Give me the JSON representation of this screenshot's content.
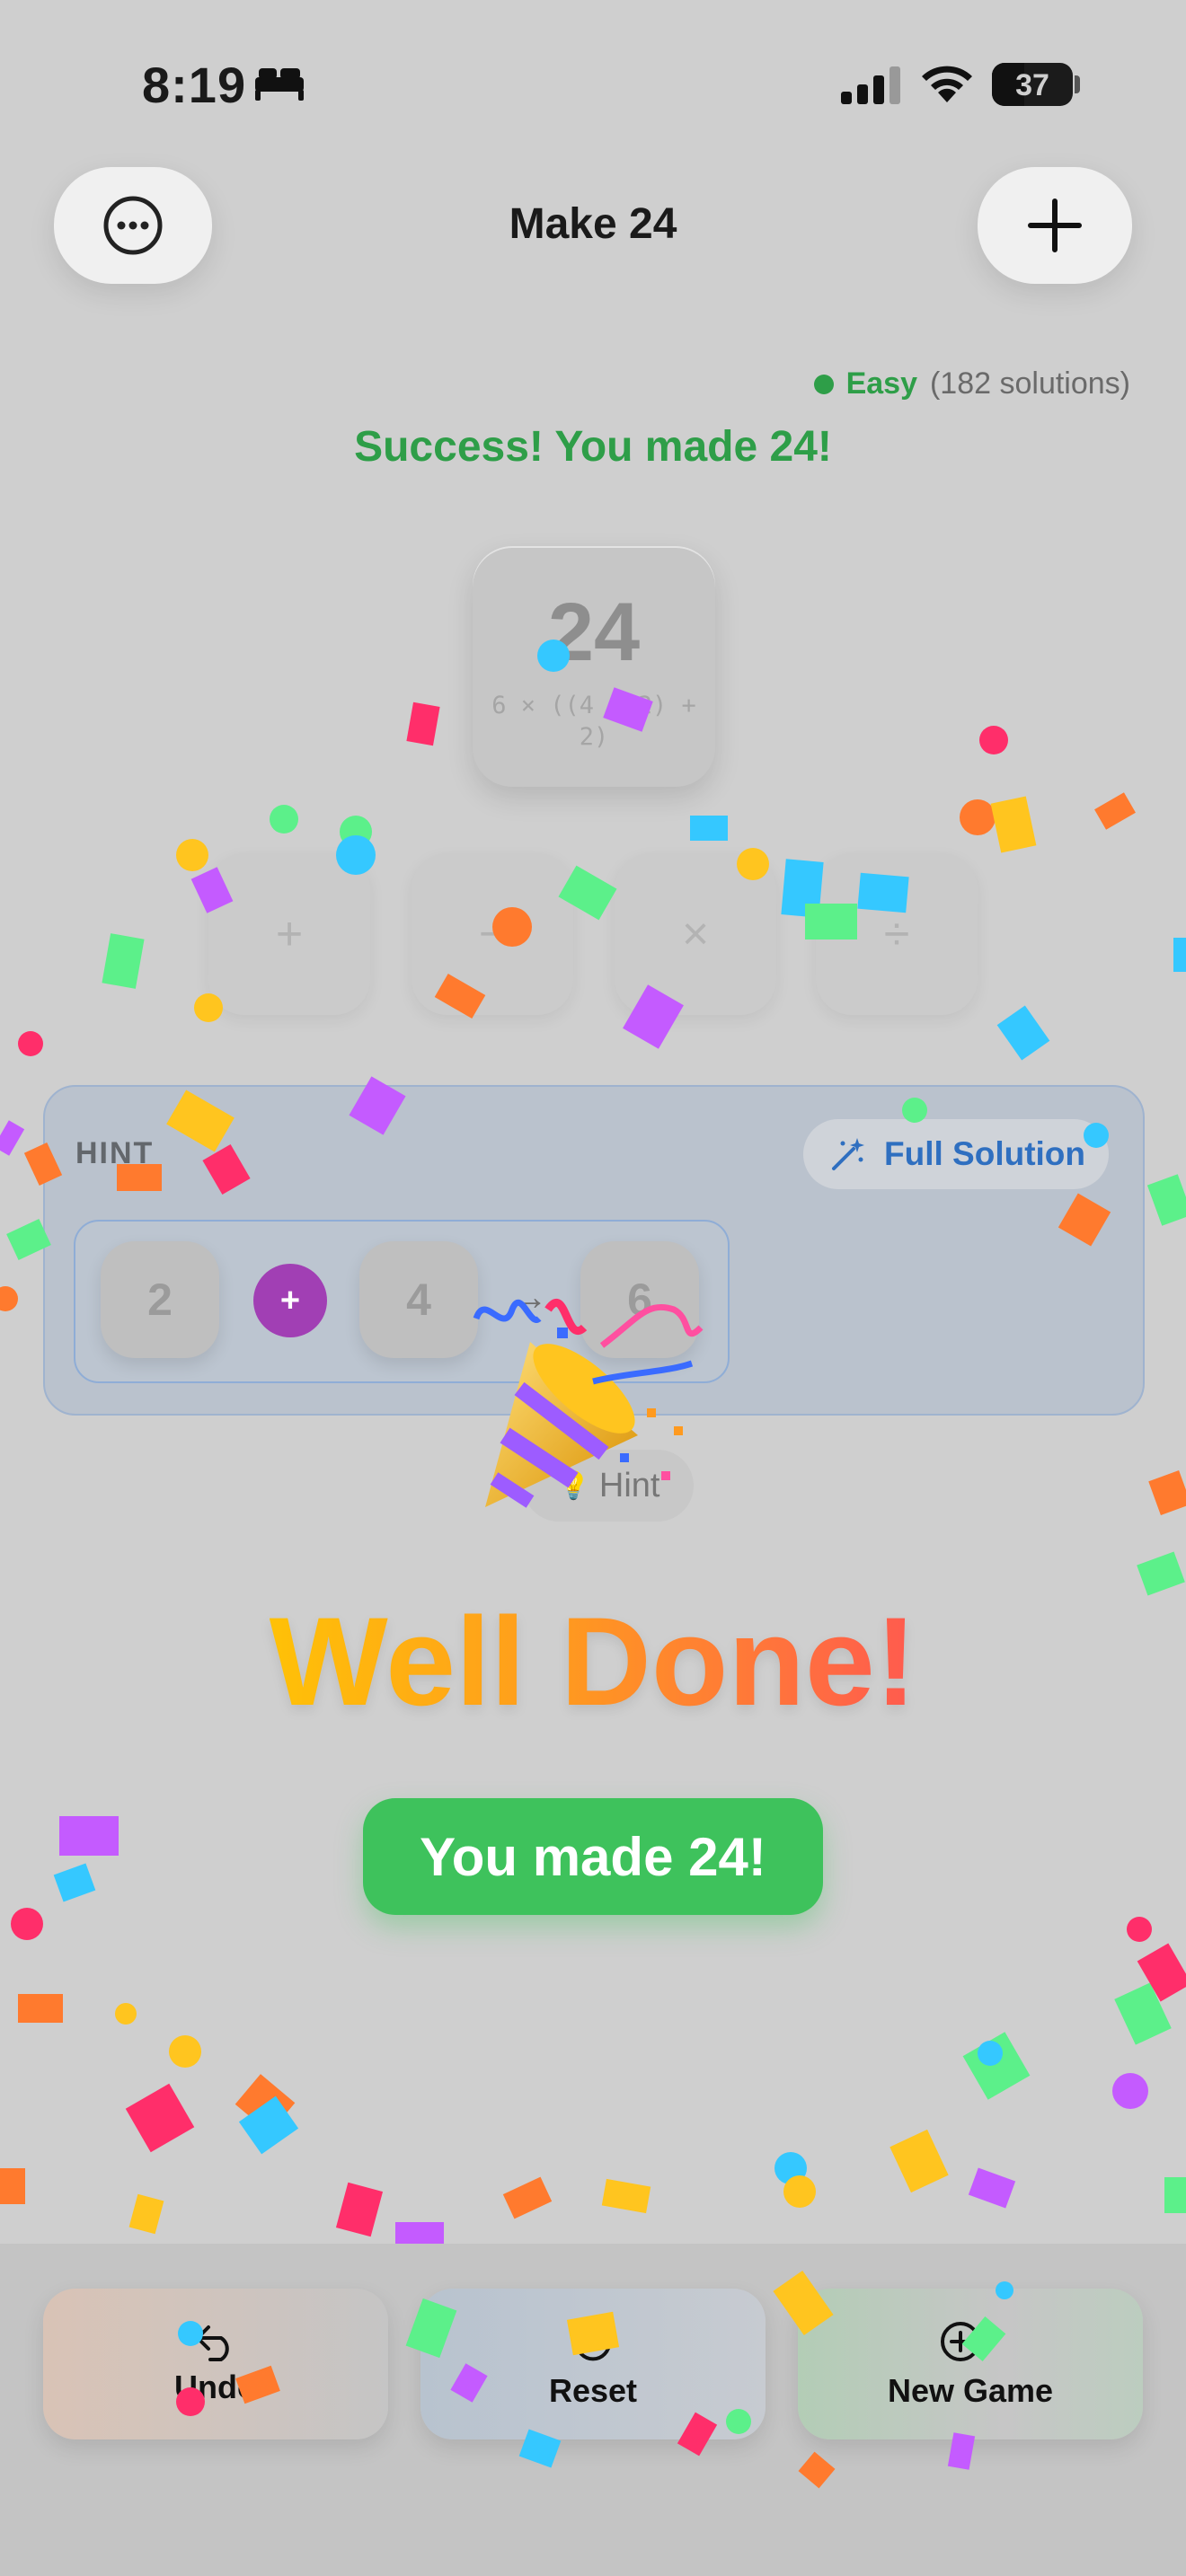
{
  "status_bar": {
    "time": "8:19",
    "battery_level": "37",
    "icons": [
      "bed-icon",
      "cellular-signal-icon",
      "wifi-icon",
      "battery-icon"
    ]
  },
  "nav": {
    "title": "Make 24",
    "left_button_icon": "ellipsis-circle-icon",
    "right_button_icon": "plus-icon"
  },
  "puzzle": {
    "difficulty": "Easy",
    "solutions": "(182 solutions)",
    "status_message": "Success! You made 24!",
    "result_value": "24",
    "result_expression": "6 × ((4 + 2) + 2)",
    "operators": [
      "+",
      "−",
      "×",
      "÷"
    ]
  },
  "hint": {
    "label": "HINT",
    "full_solution_label": "Full Solution",
    "step": {
      "left": "2",
      "op": "+",
      "right": "4",
      "arrow": "→",
      "result": "6"
    },
    "hint_button_label": "Hint"
  },
  "celebration": {
    "headline": "Well Done!",
    "badge": "You made 24!",
    "emoji": "party-popper-icon"
  },
  "bottom_bar": {
    "undo": "Undo",
    "reset": "Reset",
    "new_game": "New Game"
  },
  "colors": {
    "success_green": "#2e9e48",
    "badge_green": "#3ec25c",
    "accent_blue": "#2f6fc0",
    "operator_purple": "#a13fb4",
    "headline_gradient": [
      "#ffc107",
      "#ff9a1f",
      "#ff5a4f"
    ]
  }
}
